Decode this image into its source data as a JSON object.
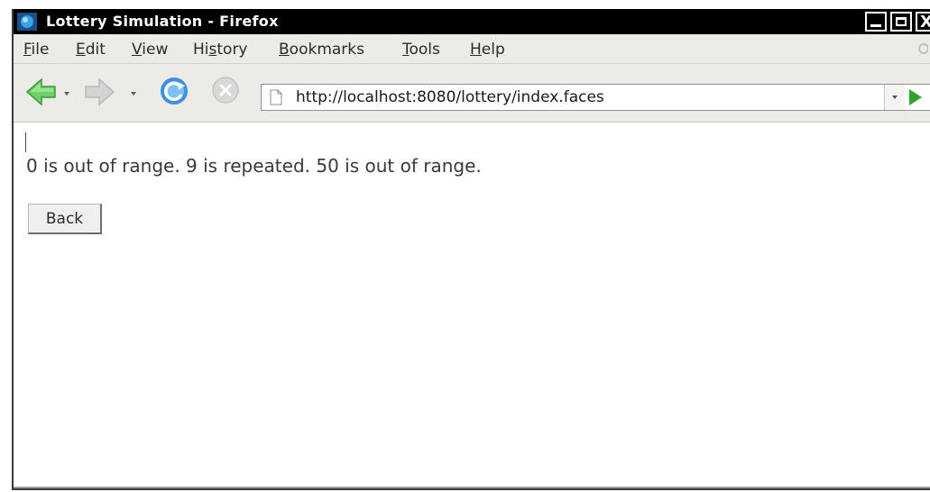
{
  "window": {
    "title": "Lottery Simulation - Firefox",
    "close_glyph": "X"
  },
  "menu": {
    "items": [
      {
        "accel": "F",
        "rest": "ile"
      },
      {
        "accel": "E",
        "rest": "dit"
      },
      {
        "accel": "V",
        "rest": "iew"
      },
      {
        "pre": "Hi",
        "accel": "s",
        "rest": "tory"
      },
      {
        "accel": "B",
        "rest": "ookmarks"
      },
      {
        "accel": "T",
        "rest": "ools"
      },
      {
        "accel": "H",
        "rest": "elp"
      }
    ]
  },
  "toolbar": {
    "url": "http://localhost:8080/lottery/index.faces"
  },
  "content": {
    "message": "0 is out of range. 9 is repeated. 50 is out of range.",
    "back_label": "Back"
  },
  "colors": {
    "titlebar_bg": "#000000",
    "chrome_bg": "#ecebe8",
    "back_arrow": "#5cc05a",
    "go_arrow": "#2fa52f",
    "reload_blue": "#3f8fe0"
  },
  "icons": {
    "app": "firefox-globe-icon",
    "back": "back-arrow-icon",
    "forward": "forward-arrow-icon",
    "reload": "reload-icon",
    "stop": "stop-icon",
    "page": "page-icon",
    "go": "go-arrow-icon"
  }
}
